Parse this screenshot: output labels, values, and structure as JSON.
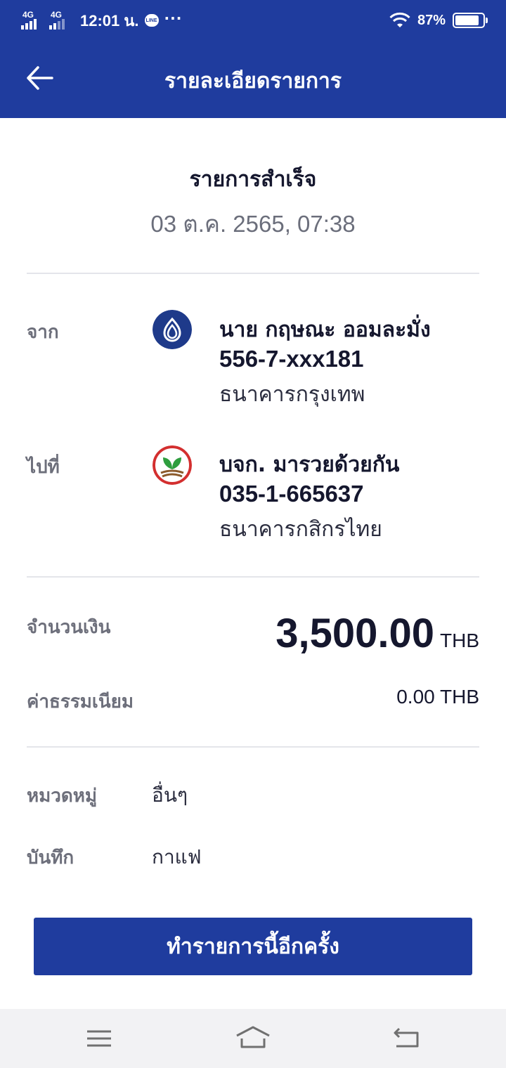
{
  "status_bar": {
    "sim1": "4G",
    "sim2": "4G",
    "time": "12:01 น.",
    "notification_app": "LINE",
    "more": "···",
    "battery": "87%",
    "battery_level": 0.87
  },
  "header": {
    "title": "รายละเอียดรายการ",
    "back_icon": "arrow-left-icon"
  },
  "transaction": {
    "status": "รายการสำเร็จ",
    "datetime": "03 ต.ค. 2565, 07:38"
  },
  "from": {
    "label": "จาก",
    "name": "นาย กฤษณะ ออมละมั่ง",
    "account": "556-7-xxx181",
    "bank": "ธนาคารกรุงเทพ",
    "logo_icon": "bangkok-bank-logo",
    "logo_color": "#1e3a8a"
  },
  "to": {
    "label": "ไปที่",
    "name": "บจก. มารวยด้วยกัน",
    "account": "035-1-665637",
    "bank": "ธนาคารกสิกรไทย",
    "logo_icon": "kasikorn-bank-logo",
    "logo_color": "#d32f2f"
  },
  "amount": {
    "label": "จำนวนเงิน",
    "value": "3,500.00",
    "currency": "THB"
  },
  "fee": {
    "label": "ค่าธรรมเนียม",
    "value": "0.00 THB"
  },
  "category": {
    "label": "หมวดหมู่",
    "value": "อื่นๆ"
  },
  "note": {
    "label": "บันทึก",
    "value": "กาแฟ"
  },
  "action": {
    "repeat_label": "ทำรายการนี้อีกครั้ง"
  },
  "nav_bar": {
    "menu_icon": "menu-icon",
    "home_icon": "home-icon",
    "back_icon": "return-icon"
  },
  "colors": {
    "primary": "#1f3c9e",
    "text": "#15172e",
    "muted": "#6d6f7b"
  }
}
